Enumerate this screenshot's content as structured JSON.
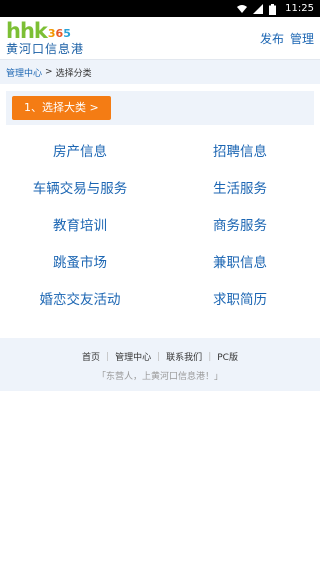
{
  "statusbar": {
    "time": "11:25"
  },
  "header": {
    "logo_hhk": "hhk",
    "logo_365": [
      "3",
      "6",
      "5"
    ],
    "logo_name": "黄河口信息港",
    "links": [
      "发布",
      "管理"
    ]
  },
  "breadcrumb": {
    "home": "管理中心",
    "separator": ">",
    "current": "选择分类"
  },
  "step": {
    "label": "1、选择大类 >"
  },
  "categories": [
    "房产信息",
    "招聘信息",
    "车辆交易与服务",
    "生活服务",
    "教育培训",
    "商务服务",
    "跳蚤市场",
    "兼职信息",
    "婚恋交友活动",
    "求职简历"
  ],
  "footer": {
    "links": [
      "首页",
      "管理中心",
      "联系我们",
      "PC版"
    ],
    "divider": "|",
    "slogan": "「东营人，上黄河口信息港！」"
  },
  "colors": {
    "accent": "#f47c14",
    "link": "#1c66b3",
    "panel": "#eef3fa"
  }
}
